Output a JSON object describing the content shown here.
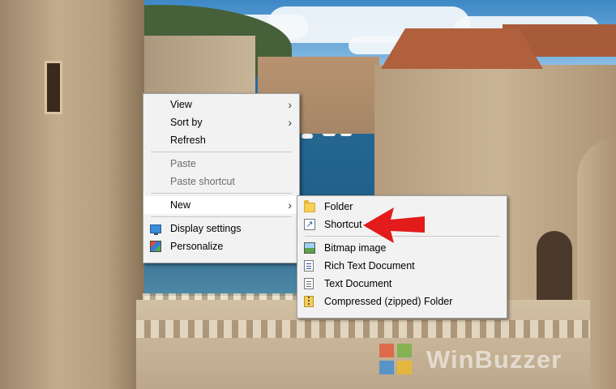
{
  "desktop": {
    "watermark": "WinBuzzer"
  },
  "context_menu": {
    "items": [
      {
        "label": "View",
        "submenu": true,
        "enabled": true
      },
      {
        "label": "Sort by",
        "submenu": true,
        "enabled": true
      },
      {
        "label": "Refresh",
        "enabled": true
      },
      {
        "label": "Paste",
        "enabled": false
      },
      {
        "label": "Paste shortcut",
        "enabled": false
      },
      {
        "label": "New",
        "submenu": true,
        "enabled": true,
        "highlighted": true
      },
      {
        "label": "Display settings",
        "icon": "display-icon",
        "enabled": true
      },
      {
        "label": "Personalize",
        "icon": "personalize-icon",
        "enabled": true
      }
    ]
  },
  "new_submenu": {
    "items": [
      {
        "label": "Folder",
        "icon": "folder-icon"
      },
      {
        "label": "Shortcut",
        "icon": "shortcut-icon"
      },
      {
        "label": "Bitmap image",
        "icon": "bitmap-icon"
      },
      {
        "label": "Rich Text Document",
        "icon": "rich-text-icon"
      },
      {
        "label": "Text Document",
        "icon": "text-document-icon"
      },
      {
        "label": "Compressed (zipped) Folder",
        "icon": "zip-folder-icon"
      }
    ]
  },
  "annotation": {
    "arrow_color": "#e31b1b",
    "points_to": "Shortcut"
  }
}
